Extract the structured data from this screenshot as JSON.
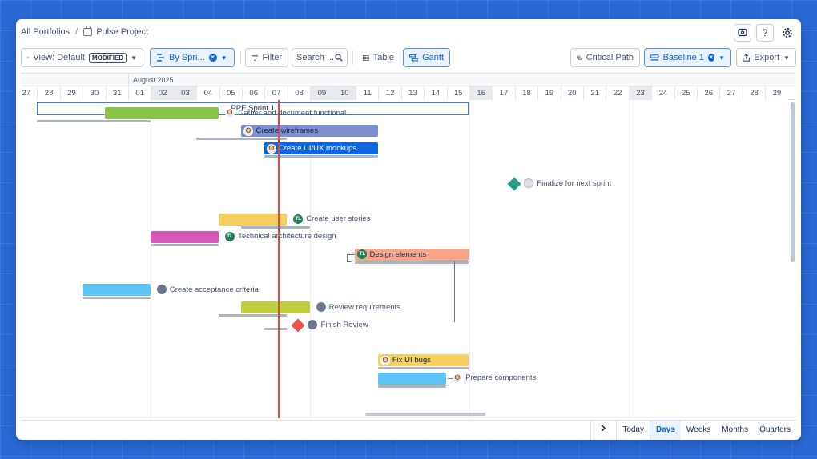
{
  "breadcrumb": {
    "root": "All Portfolios",
    "separator": "/",
    "project": "Pulse Project"
  },
  "top_icons": {
    "help": "?"
  },
  "toolbar": {
    "view_label": "View: Default",
    "view_badge": "MODIFIED",
    "group_label": "By Spri...",
    "filter_label": "Filter",
    "search_placeholder": "Search ...",
    "table_label": "Table",
    "gantt_label": "Gantt",
    "critical_path_label": "Critical Path",
    "baseline_label": "Baseline 1",
    "export_label": "Export"
  },
  "timeline": {
    "month": "August 2025",
    "days": [
      "27",
      "28",
      "29",
      "30",
      "31",
      "01",
      "02",
      "03",
      "04",
      "05",
      "06",
      "07",
      "08",
      "09",
      "10",
      "11",
      "12",
      "13",
      "14",
      "15",
      "16",
      "17",
      "18",
      "19",
      "20",
      "21",
      "22",
      "23",
      "24",
      "25",
      "26",
      "27",
      "28",
      "29"
    ],
    "weekend_days": [
      6,
      7,
      13,
      14,
      20,
      27
    ],
    "today_index": 11,
    "sprint": {
      "name": "PPE Sprint 1",
      "start_day": 0.7,
      "end_day": 19.7
    }
  },
  "tasks": [
    {
      "name": "Gather and document functional ...",
      "start": 3.7,
      "end": 8.7,
      "baseline_start": 0.7,
      "baseline_end": 5.7,
      "row": 0,
      "color": "#8bc34a",
      "label_pos": "right",
      "avatar": "face"
    },
    {
      "name": "Create wireframes",
      "start": 9.7,
      "end": 15.7,
      "baseline_start": 7.7,
      "baseline_end": 11.7,
      "row": 1,
      "color": "#7e8fd1",
      "label_pos": "inside",
      "avatar": "face",
      "text_color": "#172b4d"
    },
    {
      "name": "Create UI/UX mockups",
      "start": 10.7,
      "end": 15.7,
      "baseline_start": 10.7,
      "baseline_end": 15.7,
      "row": 2,
      "color": "#0c66e4",
      "label_pos": "inside",
      "avatar": "face",
      "text_color": "#ffffff"
    },
    {
      "name": "Finalize for next sprint",
      "milestone": 21.7,
      "row": 4,
      "color": "#2b9c8a",
      "label_pos": "right",
      "avatar": "gray"
    },
    {
      "name": "Create user stories",
      "start": 8.7,
      "end": 11.7,
      "baseline_start": 9.7,
      "baseline_end": 12.7,
      "row": 6,
      "color": "#f5cf61",
      "label_pos": "right",
      "avatar": "tl"
    },
    {
      "name": "Technical architecture design",
      "start": 5.7,
      "end": 8.7,
      "baseline_start": 5.7,
      "baseline_end": 8.7,
      "row": 7,
      "color": "#d458b8",
      "label_pos": "right",
      "avatar": "tl"
    },
    {
      "name": "Design elements",
      "start": 14.7,
      "end": 19.7,
      "baseline_start": 14.7,
      "baseline_end": 19.7,
      "row": 8,
      "color": "#f8a58a",
      "label_pos": "inside",
      "avatar": "tl",
      "text_color": "#172b4d"
    },
    {
      "name": "Create acceptance criteria",
      "start": 2.7,
      "end": 5.7,
      "baseline_start": 2.7,
      "baseline_end": 5.7,
      "row": 10,
      "color": "#5bc3f5",
      "label_pos": "right",
      "avatar": "group"
    },
    {
      "name": "Review requirements",
      "start": 9.7,
      "end": 12.7,
      "baseline_start": 8.7,
      "baseline_end": 11.7,
      "row": 11,
      "color": "#bfcf3d",
      "label_pos": "right",
      "avatar": "group"
    },
    {
      "name": "Finish Review",
      "milestone": 12.2,
      "baseline_start": 10.7,
      "baseline_end": 11.7,
      "row": 12,
      "color": "#ef5350",
      "label_pos": "right",
      "avatar": "group"
    },
    {
      "name": "Fix UI bugs",
      "start": 15.7,
      "end": 19.7,
      "baseline_start": 15.7,
      "baseline_end": 19.7,
      "row": 14,
      "color": "#f5cf61",
      "label_pos": "inside",
      "avatar": "face",
      "text_color": "#172b4d"
    },
    {
      "name": "Prepare components",
      "start": 15.7,
      "end": 18.7,
      "baseline_start": 15.7,
      "baseline_end": 18.7,
      "row": 15,
      "color": "#5bc3f5",
      "label_pos": "right",
      "avatar": "face"
    }
  ],
  "bottom": {
    "today_label": "Today",
    "zoom_options": [
      "Days",
      "Weeks",
      "Months",
      "Quarters"
    ],
    "active_zoom": "Days"
  }
}
